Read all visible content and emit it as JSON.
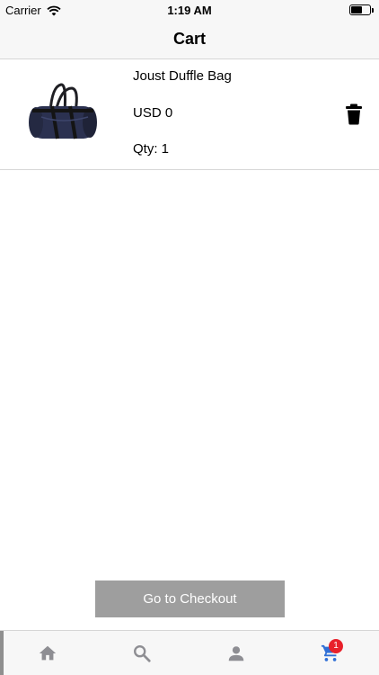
{
  "status_bar": {
    "carrier": "Carrier",
    "time": "1:19 AM",
    "battery_level": 0.6
  },
  "nav": {
    "title": "Cart"
  },
  "cart": {
    "items": [
      {
        "name": "Joust Duffle Bag",
        "price": "USD 0",
        "quantity": "Qty: 1",
        "image": "duffle-bag"
      }
    ]
  },
  "checkout": {
    "label": "Go to Checkout"
  },
  "tab_bar": {
    "tabs": [
      {
        "icon": "home-icon",
        "active": false
      },
      {
        "icon": "search-icon",
        "active": false
      },
      {
        "icon": "person-icon",
        "active": false
      },
      {
        "icon": "cart-icon",
        "active": true
      }
    ],
    "cart_badge": "1"
  },
  "colors": {
    "tab_inactive": "#8e8e93",
    "tab_active": "#2f6fd6",
    "badge": "#e8202a",
    "checkout_bg": "#9e9e9e"
  }
}
